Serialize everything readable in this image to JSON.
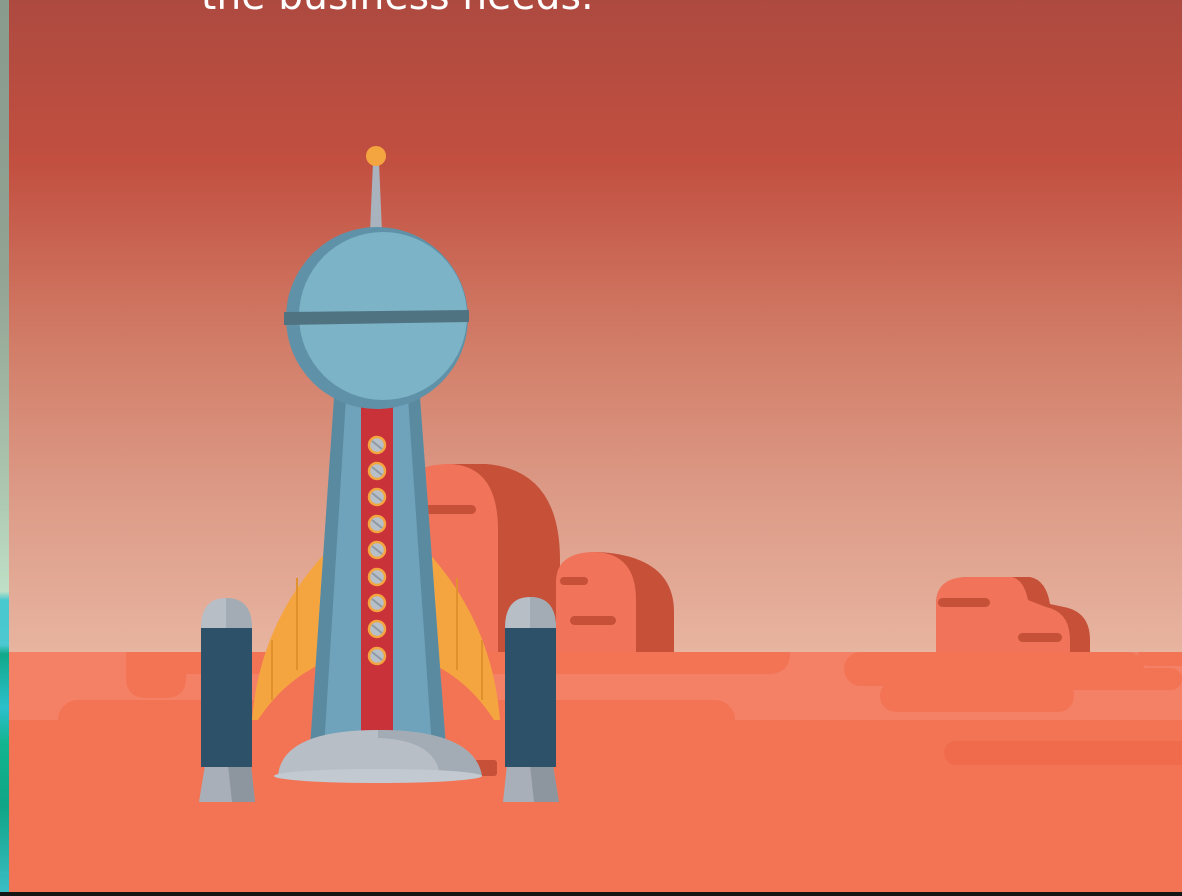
{
  "headline": "the business needs.",
  "illustration": {
    "subject": "rocket-on-mars",
    "colors": {
      "sky_top": "#ad4a40",
      "sky_bottom": "#f3c5b3",
      "ground": "#f27455",
      "ground_light": "#f48065",
      "rock": "#f0735a",
      "rock_shade": "#c65038",
      "rocket_body": "#6fa3bb",
      "rocket_dome": "#7cb3c7",
      "rocket_stripe": "#c83238",
      "rocket_band": "#4f7381",
      "booster": "#2d5169",
      "booster_cap": "#b7bec6",
      "fin": "#f5a540",
      "antenna_tip": "#f5a540"
    }
  }
}
